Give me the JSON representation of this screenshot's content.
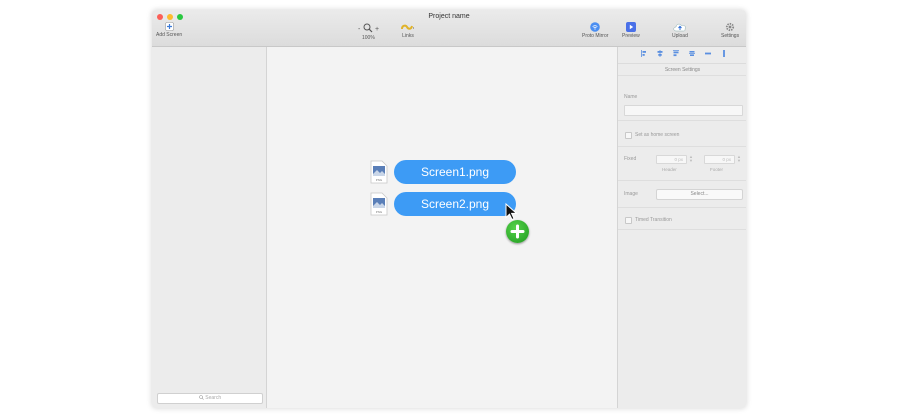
{
  "window": {
    "title": "Project name"
  },
  "toolbar": {
    "add_screen": "Add Screen",
    "zoom_minus": "-",
    "zoom_plus": "+",
    "zoom": "100%",
    "links": "Links",
    "proto_mirror": "Proto Mirror",
    "preview": "Preview",
    "upload": "Upload",
    "settings": "Settings"
  },
  "sidebar": {
    "search_placeholder": "Search"
  },
  "inspector": {
    "title": "Screen Settings",
    "name_label": "Name",
    "home_label": "Set as home screen",
    "fixed_label": "Fixed",
    "header_value": "0 px",
    "footer_value": "0 px",
    "header_label": "Header",
    "footer_label": "Footer",
    "image_label": "Image",
    "select_label": "Select...",
    "timed_label": "Timed Transition"
  },
  "canvas": {
    "files": [
      {
        "name": "Screen1.png",
        "ext": "PNG"
      },
      {
        "name": "Screen2.png",
        "ext": "PNG"
      }
    ]
  },
  "colors": {
    "accent": "#3d9bf5",
    "add_badge": "#2aa52a"
  },
  "icons": [
    "plus-icon",
    "zoom-icon",
    "link-icon",
    "wifi-icon",
    "play-icon",
    "upload-cloud-icon",
    "gear-icon",
    "search-icon",
    "align-icon",
    "file-image-icon",
    "cursor-icon",
    "add-badge-icon"
  ]
}
